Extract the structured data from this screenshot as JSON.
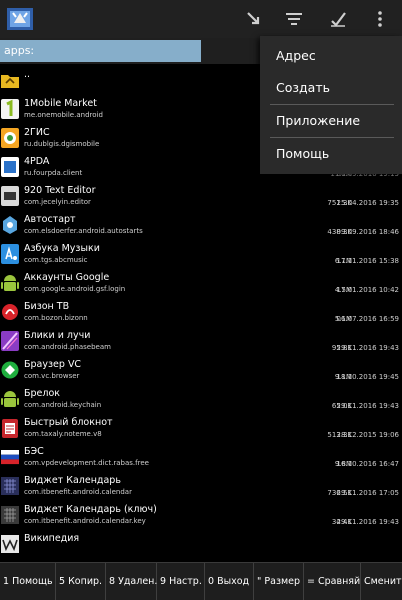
{
  "path": {
    "text": "apps:"
  },
  "menu": {
    "items": [
      {
        "label": "Адрес"
      },
      {
        "label": "Создать"
      },
      {
        "label": "Приложение"
      },
      {
        "label": "Помощь"
      }
    ]
  },
  "files": [
    {
      "name": "..",
      "pkg": "",
      "size": "",
      "date": "",
      "icon": "folder-up-icon"
    },
    {
      "name": "1Mobile Market",
      "pkg": "me.onemobile.android",
      "size": "",
      "date": "",
      "icon": "app-icon-1mobile"
    },
    {
      "name": "2ГИС",
      "pkg": "ru.dublgis.dgismobile",
      "size": "",
      "date": "",
      "icon": "app-icon-2gis"
    },
    {
      "name": "4PDA",
      "pkg": "ru.fourpda.client",
      "size": "11.1M",
      "date": "06.09.2016 19:15",
      "icon": "app-icon-4pda"
    },
    {
      "name": "920 Text Editor",
      "pkg": "com.jecelyin.editor",
      "size": "751.3K",
      "date": "25.04.2016 19:35",
      "icon": "app-icon-920-editor"
    },
    {
      "name": "Автостарт",
      "pkg": "com.elsdoerfer.android.autostarts",
      "size": "438.3K",
      "date": "09.09.2016 18:46",
      "icon": "app-icon-autostart"
    },
    {
      "name": "Азбука Музыки",
      "pkg": "com.tgs.abcmusic",
      "size": "6.1M",
      "date": "17.11.2016 15:38",
      "icon": "app-icon-azbuka"
    },
    {
      "name": "Аккаунты Google",
      "pkg": "com.google.android.gsf.login",
      "size": "4.5M",
      "date": "17.01.2016 10:42",
      "icon": "app-icon-android"
    },
    {
      "name": "Бизон ТВ",
      "pkg": "com.bozon.bizonn",
      "size": "5.1M",
      "date": "06.07.2016 16:59",
      "icon": "app-icon-bizon"
    },
    {
      "name": "Блики и лучи",
      "pkg": "com.android.phasebeam",
      "size": "95.8K",
      "date": "29.11.2016 19:43",
      "icon": "app-icon-bliki"
    },
    {
      "name": "Браузер VC",
      "pkg": "com.vc.browser",
      "size": "9.1M",
      "date": "18.10.2016 19:45",
      "icon": "app-icon-vc-browser"
    },
    {
      "name": "Брелок",
      "pkg": "com.android.keychain",
      "size": "65.0K",
      "date": "29.11.2016 19:43",
      "icon": "app-icon-android"
    },
    {
      "name": "Быстрый блокнот",
      "pkg": "com.taxaly.noteme.v8",
      "size": "513.3K",
      "date": "28.12.2015 19:06",
      "icon": "app-icon-notepad"
    },
    {
      "name": "БЭС",
      "pkg": "com.vpdevelopment.dict.rabas.free",
      "size": "9.8M",
      "date": "16.10.2016 16:47",
      "icon": "app-icon-bes"
    },
    {
      "name": "Виджет Календарь",
      "pkg": "com.itbenefit.android.calendar",
      "size": "736.5K",
      "date": "29.11.2016 17:05",
      "icon": "app-icon-calendar"
    },
    {
      "name": "Виджет Календарь (ключ)",
      "pkg": "com.itbenefit.android.calendar.key",
      "size": "34.4K",
      "date": "29.11.2016 19:43",
      "icon": "app-icon-calendar-key"
    },
    {
      "name": "Википедия",
      "pkg": "",
      "size": "",
      "date": "",
      "icon": "app-icon-wikipedia"
    }
  ],
  "fkeys": [
    {
      "label": "1 Помощь"
    },
    {
      "label": "5 Копир."
    },
    {
      "label": "8 Удален."
    },
    {
      "label": "9 Настр."
    },
    {
      "label": "0 Выход"
    },
    {
      "label": "\" Размер"
    },
    {
      "label": "= Сравняй"
    },
    {
      "label": "Сменить"
    }
  ]
}
